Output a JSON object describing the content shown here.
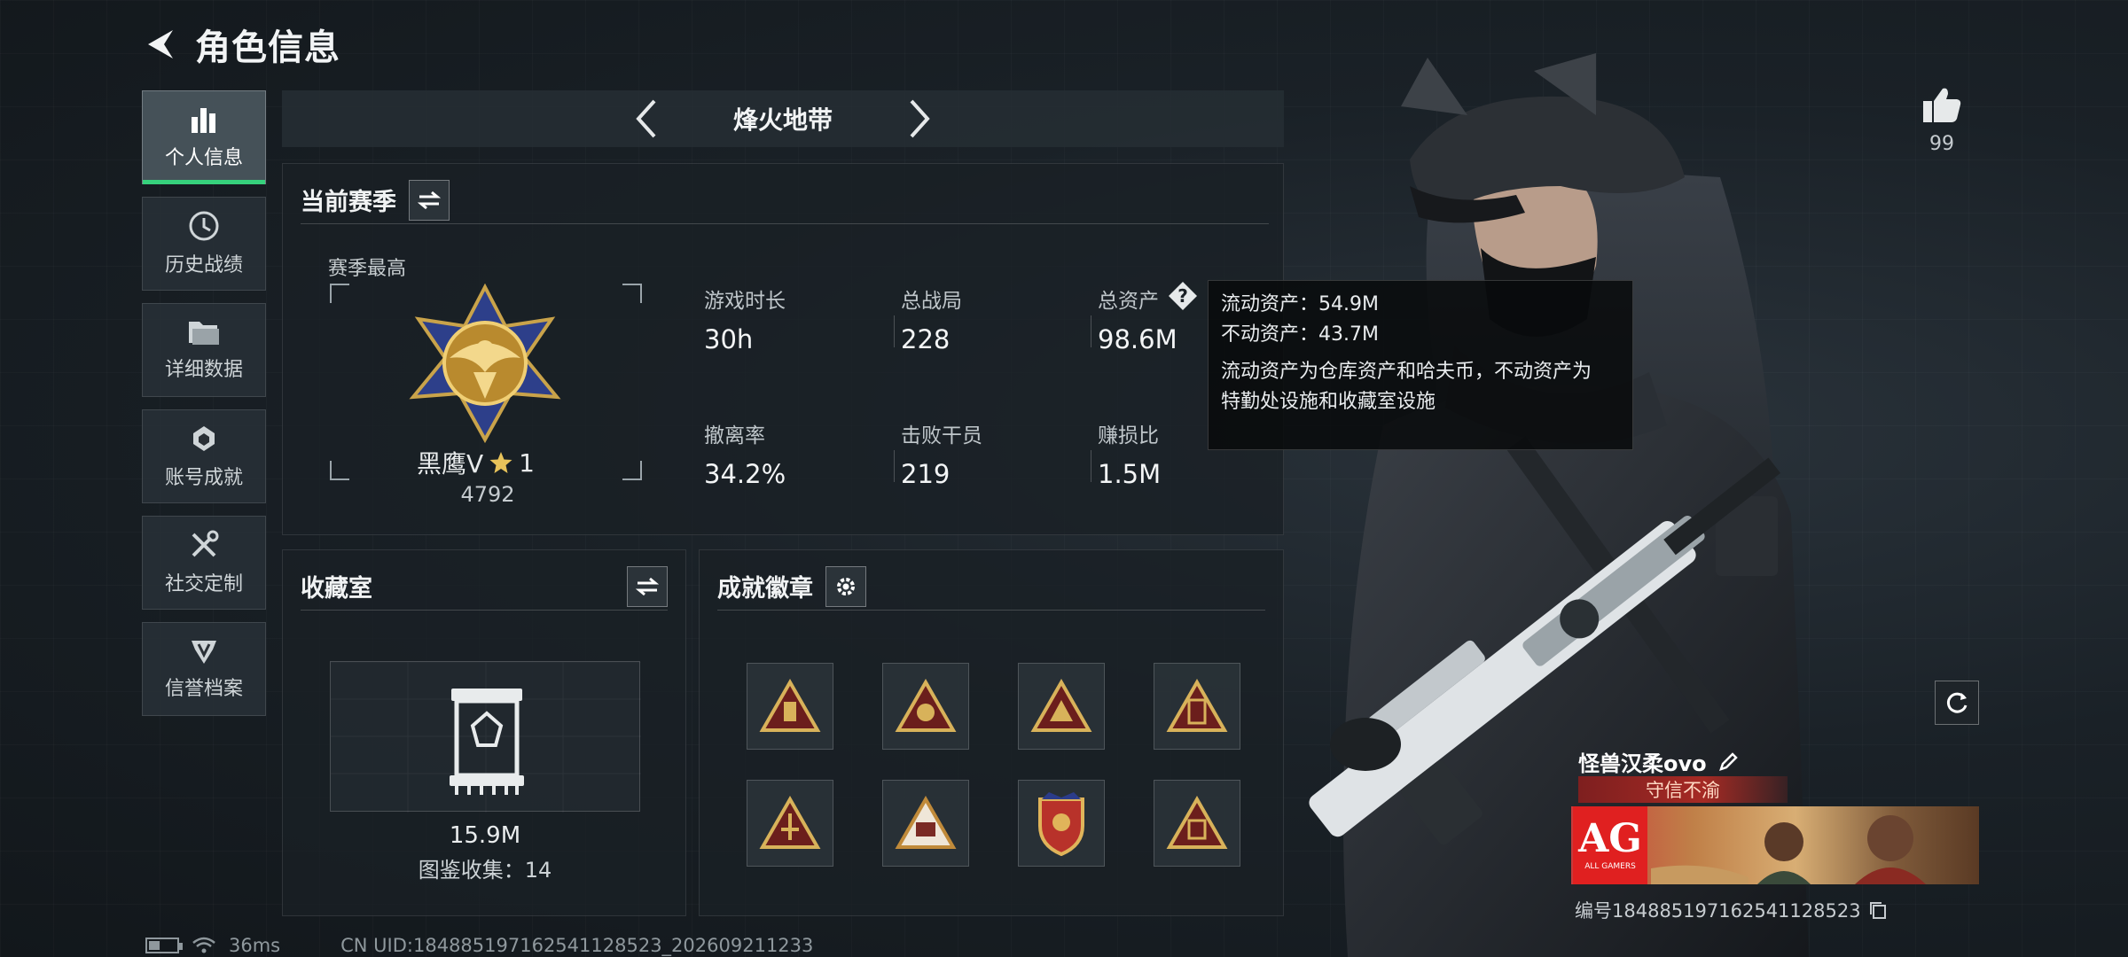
{
  "header": {
    "title": "角色信息"
  },
  "sidebar": {
    "items": [
      {
        "label": "个人信息",
        "icon": "bar-chart-icon",
        "active": true
      },
      {
        "label": "历史战绩",
        "icon": "clock-icon"
      },
      {
        "label": "详细数据",
        "icon": "folder-icon"
      },
      {
        "label": "账号成就",
        "icon": "achievement-icon"
      },
      {
        "label": "社交定制",
        "icon": "tools-icon"
      },
      {
        "label": "信誉档案",
        "icon": "reputation-icon"
      }
    ]
  },
  "season_bar": {
    "name": "烽火地带"
  },
  "current_season": {
    "title": "当前赛季",
    "rank_label": "赛季最高",
    "rank_name": "黑鹰Ⅴ",
    "rank_stars": "1",
    "rank_score": "4792",
    "stats": [
      {
        "label": "游戏时长",
        "value": "30h"
      },
      {
        "label": "总战局",
        "value": "228"
      },
      {
        "label": "总资产",
        "value": "98.6M"
      },
      {
        "label": "撤离率",
        "value": "34.2%"
      },
      {
        "label": "击败干员",
        "value": "219"
      },
      {
        "label": "赚损比",
        "value": "1.5M"
      }
    ]
  },
  "tooltip": {
    "liquid": "流动资产：54.9M",
    "fixed": "不动资产：43.7M",
    "desc_line1": "流动资产为仓库资产和哈夫币，不动资产为",
    "desc_line2": "特勤处设施和收藏室设施"
  },
  "collection": {
    "title": "收藏室",
    "value": "15.9M",
    "count": "图鉴收集：14"
  },
  "achievements": {
    "title": "成就徽章",
    "badges": 8
  },
  "likes": {
    "count": "99"
  },
  "player": {
    "name": "怪兽汉柔ovo",
    "motto": "守信不渝",
    "team_logo": "AG",
    "team_sub": "ALL GAMERS",
    "uid": "编号1848851971625411285​23"
  },
  "footer": {
    "ping": "36ms",
    "uid": "CN UID:18488519716254112852​3_202609211233"
  },
  "colors": {
    "accent": "#36d17c",
    "motto": "#a52a24",
    "team": "#e02020"
  }
}
